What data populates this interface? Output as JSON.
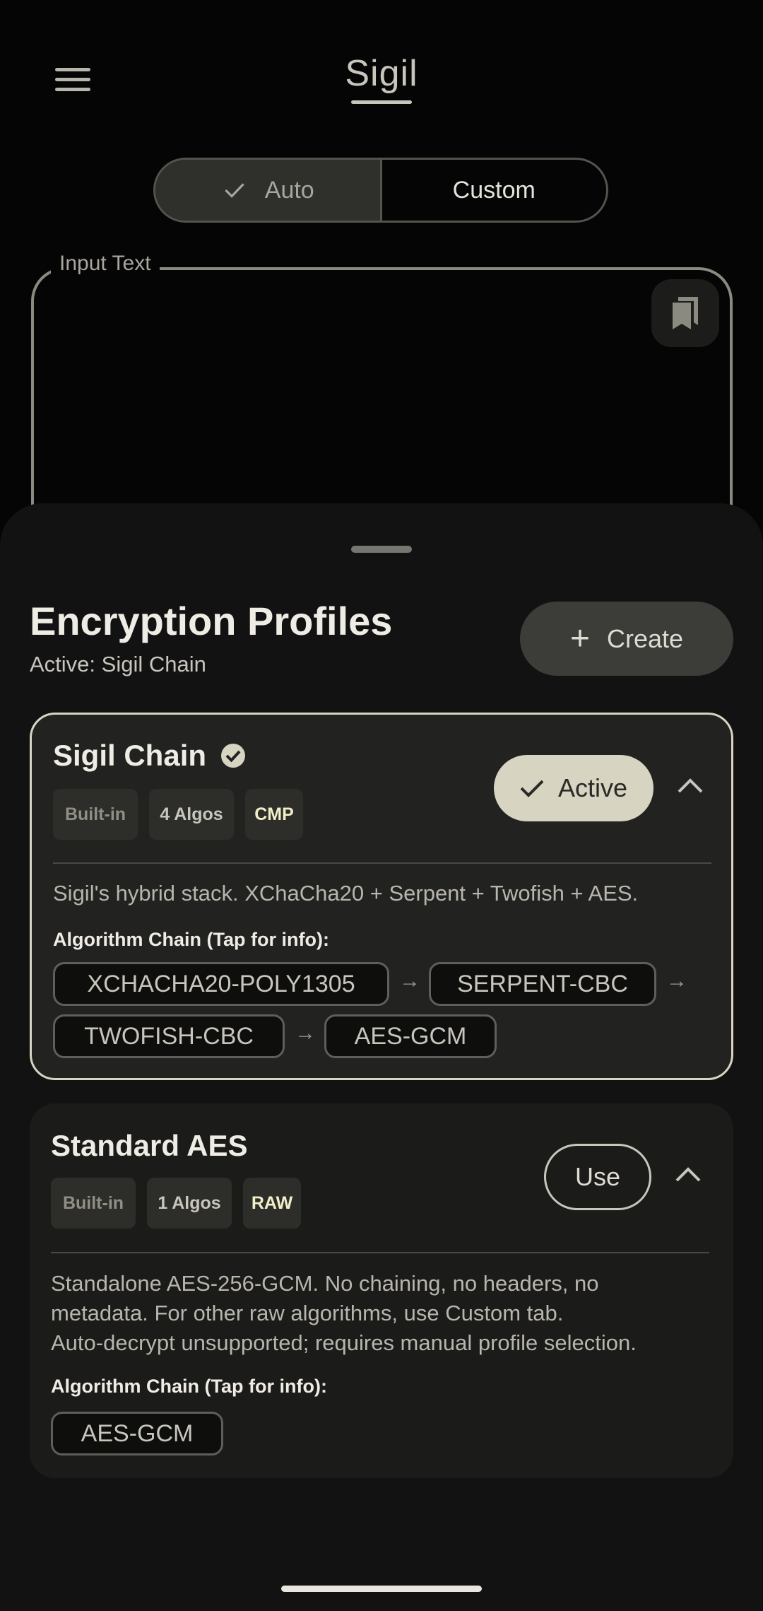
{
  "header": {
    "title": "Sigil"
  },
  "mode_toggle": {
    "auto_label": "Auto",
    "custom_label": "Custom",
    "selected": "Auto"
  },
  "input": {
    "label": "Input Text",
    "value": ""
  },
  "sheet": {
    "title": "Encryption Profiles",
    "subtitle": "Active: Sigil Chain",
    "create_label": "Create",
    "chain_label": "Algorithm Chain (Tap for info):",
    "profiles": [
      {
        "name": "Sigil Chain",
        "tags": [
          "Built-in",
          "4 Algos",
          "CMP"
        ],
        "action_label": "Active",
        "description": "Sigil's hybrid stack. XChaCha20 + Serpent + Twofish + AES.",
        "chain": [
          "XCHACHA20-POLY1305",
          "SERPENT-CBC",
          "TWOFISH-CBC",
          "AES-GCM"
        ]
      },
      {
        "name": "Standard AES",
        "tags": [
          "Built-in",
          "1 Algos",
          "RAW"
        ],
        "action_label": "Use",
        "description_lines": [
          "Standalone AES-256-GCM. No chaining, no headers, no",
          "metadata. For other raw algorithms, use Custom tab.",
          "Auto-decrypt unsupported; requires manual profile selection."
        ],
        "chain": [
          "AES-GCM"
        ]
      }
    ]
  },
  "colors": {
    "accent": "#d7d4c2",
    "background": "#050505",
    "sheet": "#121212"
  }
}
